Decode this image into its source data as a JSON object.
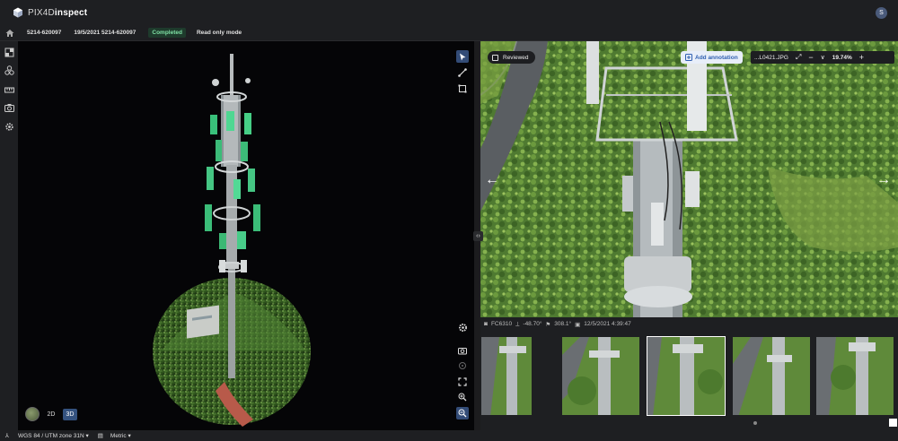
{
  "app": {
    "name_prefix": "PIX4D",
    "name_suffix": "inspect",
    "user_initial": "S"
  },
  "breadcrumb": {
    "project": "5214-620097",
    "flight": "19/5/2021 5214-620097",
    "status": "Completed",
    "mode": "Read only mode"
  },
  "sidebar": {
    "items": [
      "layers-icon",
      "objects-icon",
      "measure-icon",
      "camera-icon",
      "settings-icon"
    ]
  },
  "viewer3d": {
    "modes": [
      "2D",
      "3D"
    ],
    "active_mode": "3D"
  },
  "image_viewer": {
    "reviewed_label": "Reviewed",
    "add_annotation_label": "Add annotation",
    "filename": "...L0421.JPG",
    "zoom": "19.74%",
    "camera": "FC6310",
    "pitch": "-48.70°",
    "heading": "308.1°",
    "timestamp": "12/5/2021 4:39:47"
  },
  "footer": {
    "crs": "WGS 84 / UTM zone 31N",
    "units": "Metric"
  },
  "colors": {
    "accent": "#34527f",
    "status_green": "#7fe0a4",
    "annotation_blue": "#2f5fb0"
  }
}
